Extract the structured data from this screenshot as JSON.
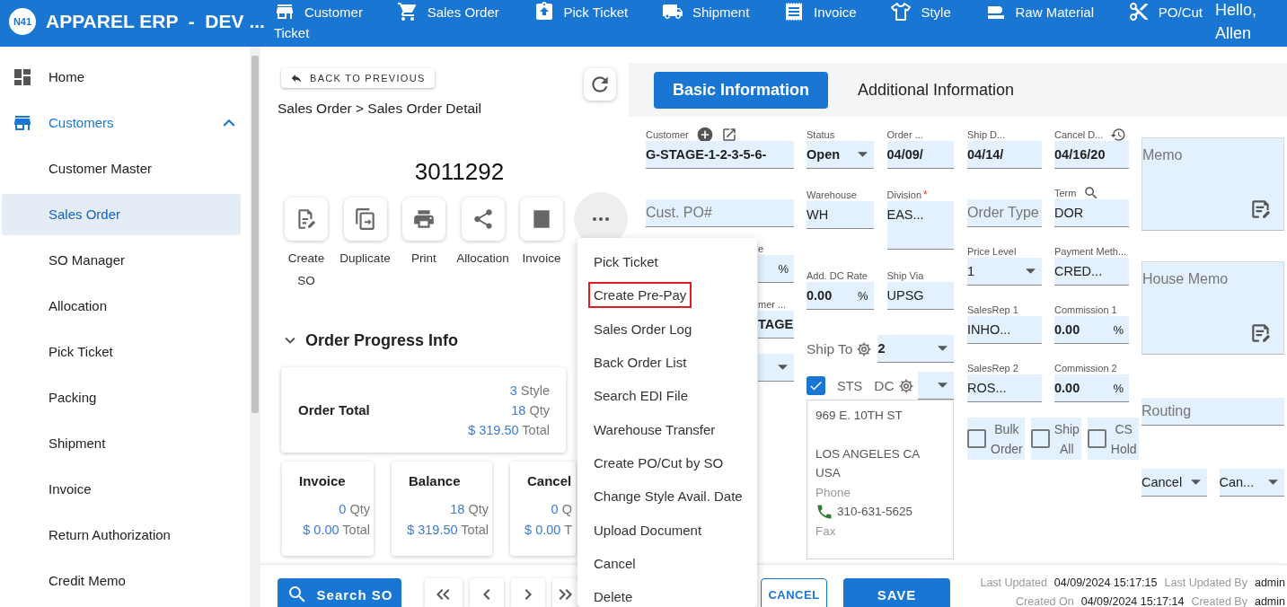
{
  "app": {
    "logo": "N41",
    "title": "APPAREL ERP  -  DEV ..."
  },
  "nav": [
    {
      "label": "Customer"
    },
    {
      "label": "Sales Order"
    },
    {
      "label": "Pick Ticket"
    },
    {
      "label": "Shipment"
    },
    {
      "label": "Invoice"
    },
    {
      "label": "Style"
    },
    {
      "label": "Raw Material"
    },
    {
      "label": "PO/Cut"
    }
  ],
  "nav_wrap": "Ticket",
  "greeting": "Hello, Allen",
  "sidebar": {
    "items": [
      {
        "label": "Home",
        "kind": "link",
        "selected": false
      },
      {
        "label": "Customers",
        "kind": "group",
        "selected": true,
        "expanded": true,
        "children": [
          {
            "label": "Customer Master",
            "selected": false
          },
          {
            "label": "Sales Order",
            "selected": true
          },
          {
            "label": "SO Manager",
            "selected": false
          },
          {
            "label": "Allocation",
            "selected": false
          },
          {
            "label": "Pick Ticket",
            "selected": false
          },
          {
            "label": "Packing",
            "selected": false
          },
          {
            "label": "Shipment",
            "selected": false
          },
          {
            "label": "Invoice",
            "selected": false
          },
          {
            "label": "Return Authorization",
            "selected": false
          },
          {
            "label": "Credit Memo",
            "selected": false
          }
        ]
      }
    ]
  },
  "back_button": "BACK TO PREVIOUS",
  "breadcrumb": "Sales Order > Sales Order Detail",
  "order_number": "3011292",
  "actions": [
    {
      "label": "Create SO"
    },
    {
      "label": "Duplicate"
    },
    {
      "label": "Print"
    },
    {
      "label": "Allocation"
    },
    {
      "label": "Invoice"
    }
  ],
  "more_button": {
    "active": true
  },
  "progress": {
    "title": "Order Progress Info",
    "expanded": true,
    "total": {
      "title": "Order Total",
      "lines": [
        {
          "value": "3",
          "unit": "Style"
        },
        {
          "value": "18",
          "unit": "Qty"
        },
        {
          "value": "$ 319.50",
          "unit": "Total"
        }
      ]
    },
    "cards": [
      {
        "title": "Invoice",
        "lines": [
          {
            "value": "0",
            "unit": "Qty"
          },
          {
            "value": "$ 0.00",
            "unit": "Total"
          }
        ]
      },
      {
        "title": "Balance",
        "lines": [
          {
            "value": "18",
            "unit": "Qty"
          },
          {
            "value": "$ 319.50",
            "unit": "Total"
          }
        ]
      },
      {
        "title": "Cancel",
        "lines": [
          {
            "value": "0",
            "unit": "Q"
          },
          {
            "value": "$ 0.00",
            "unit": "T"
          }
        ]
      }
    ]
  },
  "tabs": [
    {
      "label": "Basic Information",
      "selected": true
    },
    {
      "label": "Additional Information",
      "selected": false
    }
  ],
  "form": {
    "groups": [
      {
        "rows": [
          {
            "fields": [
              {
                "kind": "input",
                "label": "Customer",
                "value": "G-STAGE-1-2-3-5-6-"
              }
            ]
          },
          {
            "fields": [
              {
                "kind": "placeholder",
                "placeholder": "Cust. PO#"
              }
            ]
          },
          {
            "fields": [
              {
                "kind": "fragment",
                "label": "e",
                "suffix": "%"
              }
            ]
          },
          {
            "fields": [
              {
                "kind": "fragment",
                "label": "mer ...",
                "value": "TAGE"
              }
            ]
          },
          {
            "fields": [
              {
                "kind": "fragment_select"
              }
            ]
          }
        ]
      },
      {
        "rows": [
          {
            "fields": [
              {
                "kind": "select",
                "label": "Status",
                "value": "Open"
              },
              {
                "kind": "input",
                "label": "Order ...",
                "value": "04/09/"
              }
            ]
          },
          {
            "fields": [
              {
                "kind": "lookup",
                "label": "Warehouse",
                "value": "WH"
              },
              {
                "kind": "area",
                "label": "Division",
                "required_mark": "*",
                "value": "EAS..."
              }
            ]
          },
          {
            "fields": [
              {
                "kind": "input",
                "label": "Add. DC Rate",
                "value": "0.00",
                "suffix": "%"
              },
              {
                "kind": "lookup",
                "label": "Ship Via",
                "value": "UPSG"
              }
            ]
          },
          {
            "fields": [
              {
                "kind": "gear_label",
                "label": "Ship To"
              },
              {
                "kind": "select",
                "value": "2"
              }
            ]
          },
          {
            "fields": [
              {
                "kind": "checkbox",
                "label": "STS",
                "checked": true
              },
              {
                "kind": "gear_label",
                "label": "DC"
              },
              {
                "kind": "select"
              }
            ]
          },
          {
            "fields": [
              {
                "kind": "address",
                "lines": [
                  "969 E. 10TH ST",
                  "LOS ANGELES CA",
                  "USA"
                ],
                "phone_label": "Phone",
                "phone": "310-631-5625",
                "fax_label": "Fax"
              }
            ]
          }
        ]
      },
      {
        "rows": [
          {
            "fields": [
              {
                "kind": "input",
                "label": "Ship D...",
                "value": "04/14/"
              },
              {
                "kind": "input",
                "label": "Cancel D...",
                "value": "04/16/20"
              }
            ]
          },
          {
            "fields": [
              {
                "kind": "placeholder",
                "placeholder": "Order Type"
              },
              {
                "kind": "lookup",
                "label": "Term",
                "value": "DOR"
              }
            ]
          },
          {
            "fields": [
              {
                "kind": "select",
                "label": "Price Level",
                "value": "1"
              },
              {
                "kind": "lookup",
                "label": "Payment Meth...",
                "value": "CRED..."
              }
            ]
          },
          {
            "fields": [
              {
                "kind": "lookup",
                "label": "SalesRep 1",
                "value": "INHO..."
              },
              {
                "kind": "input",
                "label": "Commission 1",
                "value": "0.00",
                "suffix": "%"
              }
            ]
          },
          {
            "fields": [
              {
                "kind": "lookup",
                "label": "SalesRep 2",
                "value": "ROS..."
              },
              {
                "kind": "input",
                "label": "Commission 2",
                "value": "0.00",
                "suffix": "%"
              }
            ]
          },
          {
            "fields": [
              {
                "kind": "flag",
                "label": "Bulk Order",
                "checked": false
              },
              {
                "kind": "flag",
                "label": "Ship All",
                "checked": false
              },
              {
                "kind": "flag",
                "label": "CS Hold",
                "checked": false
              }
            ]
          }
        ]
      },
      {
        "rows": [
          {
            "fields": [
              {
                "kind": "memo",
                "placeholder": "Memo"
              }
            ]
          },
          {
            "fields": [
              {
                "kind": "memo",
                "placeholder": "House Memo"
              }
            ]
          },
          {
            "fields": [
              {
                "kind": "placeholder",
                "placeholder": "Routing"
              }
            ]
          },
          {
            "fields": [
              {
                "kind": "select",
                "value": "Cancel"
              },
              {
                "kind": "select",
                "value": "Can..."
              }
            ]
          }
        ]
      }
    ]
  },
  "footer": {
    "search_button": "Search SO",
    "cancel_button": "CANCEL",
    "save_button": "SAVE",
    "meta": [
      [
        {
          "label": "Last Updated",
          "value": "04/09/2024 15:17:15"
        },
        {
          "label": "Last Updated By",
          "value": "admin"
        }
      ],
      [
        {
          "label": "Created On",
          "value": "04/09/2024 15:17:14"
        },
        {
          "label": "Created By",
          "value": "admin"
        }
      ]
    ]
  },
  "menu": {
    "items": [
      {
        "label": "Pick Ticket",
        "marked": false
      },
      {
        "label": "Create Pre-Pay",
        "marked": true
      },
      {
        "label": "Sales Order Log",
        "marked": false
      },
      {
        "label": "Back Order List",
        "marked": false
      },
      {
        "label": "Search EDI File",
        "marked": false
      },
      {
        "label": "Warehouse Transfer",
        "marked": false
      },
      {
        "label": "Create PO/Cut by SO",
        "marked": false
      },
      {
        "label": "Change Style Avail. Date",
        "marked": false
      },
      {
        "label": "Upload Document",
        "marked": false
      },
      {
        "label": "Cancel",
        "marked": false
      },
      {
        "label": "Delete",
        "marked": false
      }
    ]
  }
}
